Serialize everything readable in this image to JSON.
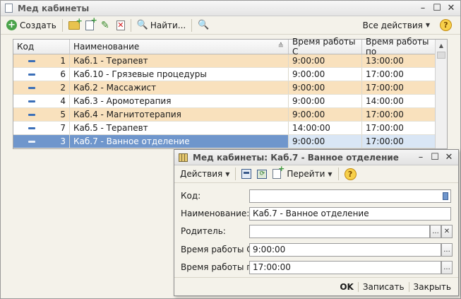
{
  "main_window": {
    "title": "Мед кабинеты",
    "controls": {
      "minimize": "–",
      "maximize": "☐",
      "close": "✕"
    },
    "toolbar": {
      "create_label": "Создать",
      "find_label": "Найти...",
      "all_actions_label": "Все действия",
      "help_label": "?"
    }
  },
  "table": {
    "columns": [
      "Код",
      "Наименование",
      "Время работы С",
      "Время работы по"
    ],
    "rows": [
      {
        "code": "1",
        "name": "Каб.1 - Терапевт",
        "from": "9:00:00",
        "to": "13:00:00"
      },
      {
        "code": "6",
        "name": "Каб.10 - Грязевые процедуры",
        "from": "9:00:00",
        "to": "17:00:00"
      },
      {
        "code": "2",
        "name": "Каб.2 - Массажист",
        "from": "9:00:00",
        "to": "17:00:00"
      },
      {
        "code": "4",
        "name": "Каб.3 - Аромотерапия",
        "from": "9:00:00",
        "to": "14:00:00"
      },
      {
        "code": "5",
        "name": "Каб.4 - Магнитотерапия",
        "from": "9:00:00",
        "to": "17:00:00"
      },
      {
        "code": "7",
        "name": "Каб.5 - Терапевт",
        "from": "14:00:00",
        "to": "17:00:00"
      },
      {
        "code": "3",
        "name": "Каб.7 - Ванное отделение",
        "from": "9:00:00",
        "to": "17:00:00"
      }
    ]
  },
  "dialog": {
    "title": "Мед кабинеты: Каб.7 - Ванное отделение",
    "controls": {
      "minimize": "–",
      "maximize": "☐",
      "close": "✕"
    },
    "toolbar": {
      "actions_label": "Действия",
      "goto_label": "Перейти",
      "help_label": "?"
    },
    "fields": {
      "code_label": "Код:",
      "code_value": "",
      "name_label": "Наименование:",
      "name_value": "Каб.7 - Ванное отделение",
      "parent_label": "Родитель:",
      "parent_value": "",
      "from_label": "Время работы С:",
      "from_value": "9:00:00",
      "to_label": "Время работы по:",
      "to_value": "17:00:00",
      "choose_button": "...",
      "clear_button": "✕"
    },
    "footer": {
      "ok_label": "OK",
      "save_label": "Записать",
      "close_label": "Закрыть"
    }
  }
}
